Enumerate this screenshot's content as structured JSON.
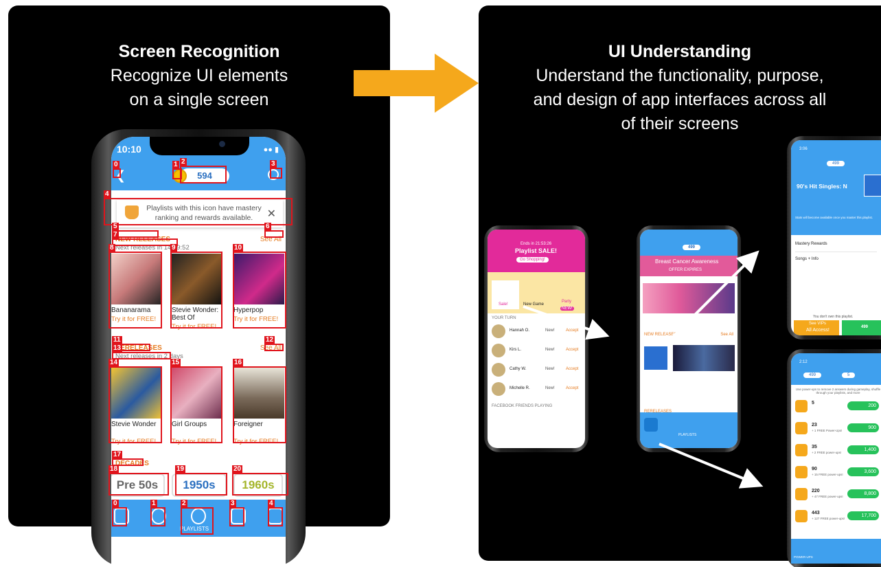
{
  "left_panel": {
    "title": "Screen Recognition",
    "subtitle_line1": "Recognize UI elements",
    "subtitle_line2": "on a single screen"
  },
  "right_panel": {
    "title": "UI Understanding",
    "subtitle_line1": "Understand the functionality, purpose,",
    "subtitle_line2": "and design of app interfaces across all",
    "subtitle_line3": "of their screens"
  },
  "colors": {
    "arrow": "#f5a81c",
    "annotation": "#e0141c",
    "app_blue": "#3fa0ee",
    "accent_orange": "#e57a1e"
  },
  "main_phone": {
    "time": "10:10",
    "coins": "594",
    "banner_text": "Playlists with this icon have mastery ranking and rewards available.",
    "new_releases": {
      "label": "NEW RELEASES",
      "subtitle": "Next releases in 14:49:52",
      "see_all": "See All"
    },
    "rereleases": {
      "label": "RERELEASES",
      "subtitle": "Next releases in 2 days",
      "see_all": "See All"
    },
    "albums_new": [
      {
        "name": "Bananarama",
        "cta": "Try it for FREE!"
      },
      {
        "name": "Stevie Wonder: Best Of",
        "cta": "Try it for FREE!"
      },
      {
        "name": "Hyperpop",
        "cta": "Try it for FREE!"
      }
    ],
    "albums_re": [
      {
        "name": "Stevie Wonder",
        "cta": "Try it for FREE!"
      },
      {
        "name": "Girl Groups",
        "cta": "Try it for FREE!"
      },
      {
        "name": "Foreigner",
        "cta": "Try it for FREE!"
      }
    ],
    "decades": {
      "label": "DECADES",
      "items": [
        "Pre 50s",
        "1950s",
        "1960s"
      ]
    },
    "tabbar": {
      "playlists_label": "PLAYLISTS"
    },
    "annotation_numbers_top": [
      "0",
      "1",
      "2",
      "3",
      "4",
      "5",
      "6",
      "7",
      "8",
      "9",
      "10",
      "11",
      "12",
      "13",
      "14",
      "15",
      "16",
      "17",
      "18",
      "19",
      "20"
    ],
    "annotation_numbers_tab": [
      "0",
      "1",
      "2",
      "3",
      "4"
    ]
  },
  "mini_phone_home": {
    "sale_title": "Playlist SALE!",
    "sale_ends": "Ends in 21:53:26",
    "go_shopping": "Go Shopping!",
    "sale_tag": "Sale!",
    "new_game": "New Game",
    "party": "Party",
    "new_badge": "NEW!",
    "your_turn": "YOUR TURN",
    "players": [
      {
        "name": "Hannah O.",
        "status": "New!",
        "action": "Accept"
      },
      {
        "name": "Kirs L.",
        "status": "New!",
        "action": "Accept"
      },
      {
        "name": "Cathy W.",
        "status": "New!",
        "action": "Accept"
      },
      {
        "name": "Michelle R.",
        "status": "New!",
        "action": "Accept"
      }
    ],
    "friends_playing": "FACEBOOK FRIENDS PLAYING",
    "coins": "499"
  },
  "mini_phone_playlists": {
    "coins": "499",
    "banner_title": "Breast Cancer Awareness",
    "offer": "OFFER EXPIRES",
    "new_releases": "NEW RELEASES",
    "see_all": "See All",
    "rereleases": "RERELEASES",
    "tab_label": "PLAYLISTS"
  },
  "mini_phone_detail": {
    "time": "3:06",
    "coins": "499",
    "title": "90's Hit Singles: N",
    "stats_note": "Stats will become available once you master this playlist.",
    "mastery": "Mastery Rewards",
    "songs": "Songs + Info",
    "dont_own": "You don't own this playlist.",
    "see_vips": "See VIPs",
    "all_access": "All Access!",
    "price": "499"
  },
  "mini_phone_powerups": {
    "time": "2:12",
    "coins": "499",
    "powerups": "5",
    "note": "Use power-ups to remove 2 answers during gameplay, shuffle through your playlists, and more",
    "rows": [
      {
        "qty": "5",
        "desc": "",
        "price": "200"
      },
      {
        "qty": "23",
        "desc": "+ 1 FREE Power-Ups!",
        "price": "900"
      },
      {
        "qty": "35",
        "desc": "+ 2 FREE power-ups!",
        "price": "1,400"
      },
      {
        "qty": "90",
        "desc": "+ 15 FREE power-ups!",
        "price": "3,600"
      },
      {
        "qty": "220",
        "desc": "+ 47 FREE power-ups!",
        "price": "8,800"
      },
      {
        "qty": "443",
        "desc": "+ 127 FREE power-ups!",
        "price": "17,700"
      }
    ],
    "tab_label": "POWER-UPS"
  }
}
